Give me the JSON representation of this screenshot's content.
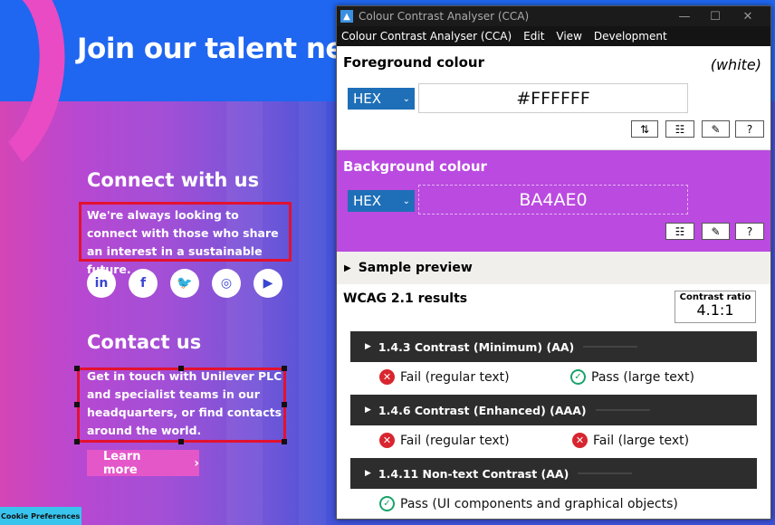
{
  "website": {
    "title": "Join our talent net",
    "connect_heading": "Connect with us",
    "connect_text": "We're always looking to connect with those who share an interest in a sustainable future.",
    "socials": [
      {
        "label": "in",
        "icon": "linkedin-icon"
      },
      {
        "label": "f",
        "icon": "facebook-icon"
      },
      {
        "label": "🐦",
        "icon": "twitter-icon"
      },
      {
        "label": "◎",
        "icon": "instagram-icon"
      },
      {
        "label": "▶",
        "icon": "youtube-icon"
      }
    ],
    "contact_heading": "Contact us",
    "contact_text": "Get in touch with Unilever PLC and specialist teams in our headquarters, or find contacts around the world.",
    "learn_more": "Learn more",
    "cookie": "Cookie Preferences"
  },
  "app": {
    "title": "Colour Contrast Analyser (CCA)",
    "menu": [
      "Colour Contrast Analyser (CCA)",
      "Edit",
      "View",
      "Development"
    ],
    "foreground": {
      "heading": "Foreground colour",
      "name": "(white)",
      "format": "HEX",
      "value": "#FFFFFF"
    },
    "background": {
      "heading": "Background colour",
      "format": "HEX",
      "value": "BA4AE0",
      "color": "#BA4AE0"
    },
    "sample_preview": "Sample preview",
    "wcag": {
      "heading": "WCAG 2.1 results",
      "ratio_label": "Contrast ratio",
      "ratio_value": "4.1:1",
      "criteria": [
        {
          "label": "1.4.3 Contrast (Minimum) (AA)",
          "results": [
            {
              "status": "fail",
              "text": "Fail (regular text)"
            },
            {
              "status": "pass",
              "text": "Pass (large text)"
            }
          ]
        },
        {
          "label": "1.4.6 Contrast (Enhanced) (AAA)",
          "results": [
            {
              "status": "fail",
              "text": "Fail (regular text)"
            },
            {
              "status": "fail",
              "text": "Fail (large text)"
            }
          ]
        },
        {
          "label": "1.4.11 Non-text Contrast (AA)",
          "results": [
            {
              "status": "pass",
              "text": "Pass (UI components and graphical objects)"
            }
          ]
        }
      ]
    }
  }
}
